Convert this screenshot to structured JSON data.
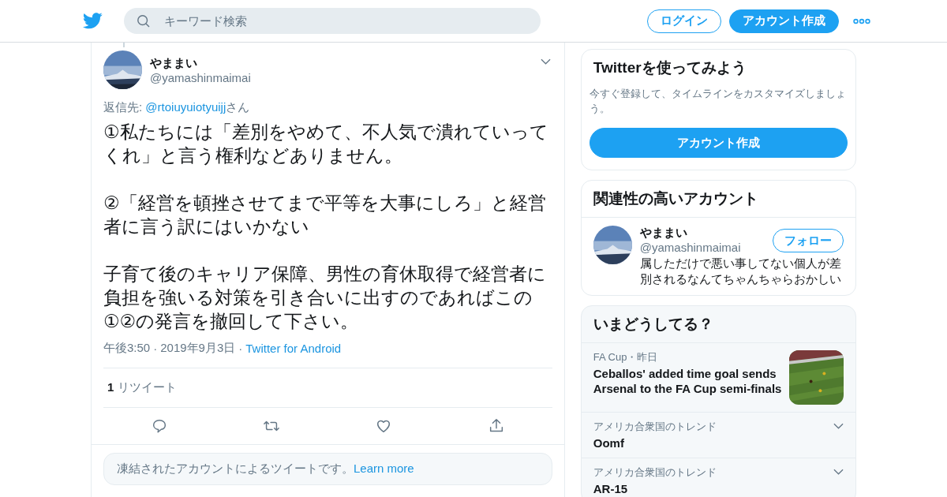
{
  "header": {
    "search": {
      "placeholder": "キーワード検索"
    },
    "buttons": [
      {
        "label": "ログイン",
        "kind": "outline"
      },
      {
        "label": "アカウント作成",
        "kind": "filled"
      }
    ]
  },
  "tweet": {
    "name": "やままい",
    "handle": "@yamashinmaimai",
    "reply_prefix": "返信先: ",
    "reply_to": "@rtoiuyuiotyuijj",
    "reply_suffix": "さん",
    "paragraphs": [
      "①私たちには「差別をやめて、不人気で潰れていってくれ」と言う権利などありません。",
      "②「経営を頓挫させてまで平等を大事にしろ」と経営者に言う訳にはいかない",
      "子育て後のキャリア保障、男性の育休取得で経営者に負担を強いる対策を引き合いに出すのであればこの①②の発言を撤回して下さい。"
    ],
    "time": "午後3:50",
    "separator": "·",
    "date": "2019年9月3日",
    "source": "Twitter for Android",
    "retweet_count": "1",
    "retweet_label": "リツイート",
    "notice": "凍結されたアカウントによるツイートです。",
    "notice_link": "Learn more"
  },
  "signup_card": {
    "title": "Twitterを使ってみよう",
    "text": "今すぐ登録して、タイムラインをカスタマイズしましょう。",
    "button": "アカウント作成"
  },
  "related_card": {
    "title": "関連性の高いアカウント",
    "accounts": [
      {
        "name": "やままい",
        "handle": "@yamashinmaimai",
        "button": "フォロー",
        "bio": "属しただけで悪い事してない個人が差別されるなんてちゃんちゃらおかしい"
      }
    ]
  },
  "trends_card": {
    "title": "いまどうしてる？",
    "items": [
      {
        "kind": "news",
        "context": "FA Cup・昨日",
        "title": "Ceballos' added time goal sends Arsenal to the FA Cup semi-finals"
      },
      {
        "kind": "trend",
        "context": "アメリカ合衆国のトレンド",
        "title": "Oomf"
      },
      {
        "kind": "trend",
        "context": "アメリカ合衆国のトレンド",
        "title": "AR-15"
      }
    ]
  }
}
